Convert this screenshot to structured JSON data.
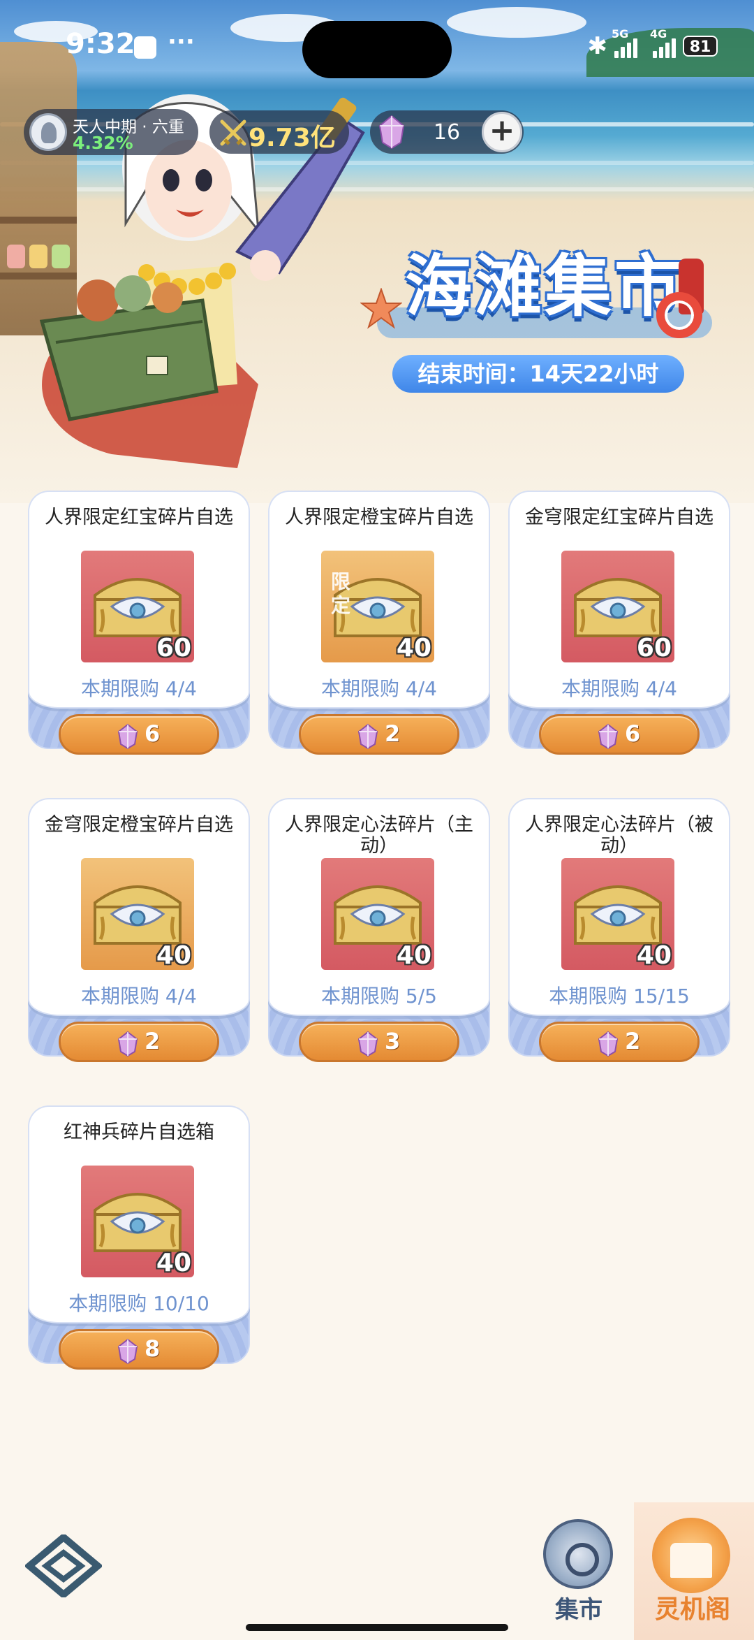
{
  "status_bar": {
    "time": "9:32",
    "more": "···",
    "bluetooth": "✱",
    "signal_1": "5G",
    "signal_2": "4G",
    "battery": "81"
  },
  "top_bar": {
    "realm_title": "天人中期 · 六重",
    "realm_percent": "4.32%",
    "power_value": "9.73亿",
    "gem_count": "16",
    "add_symbol": "+"
  },
  "event": {
    "title": "海滩集市",
    "end_time": "结束时间：14天22小时"
  },
  "shop": {
    "items": [
      {
        "title": "人界限定红宝碎片自选",
        "qty": "60",
        "limit": "本期限购 4/4",
        "price": "6",
        "bg": "red",
        "tag": ""
      },
      {
        "title": "人界限定橙宝碎片自选",
        "qty": "40",
        "limit": "本期限购 4/4",
        "price": "2",
        "bg": "orange",
        "tag": "限定"
      },
      {
        "title": "金穹限定红宝碎片自选",
        "qty": "60",
        "limit": "本期限购 4/4",
        "price": "6",
        "bg": "red",
        "tag": ""
      },
      {
        "title": "金穹限定橙宝碎片自选",
        "qty": "40",
        "limit": "本期限购 4/4",
        "price": "2",
        "bg": "orange",
        "tag": ""
      },
      {
        "title": "人界限定心法碎片（主动）",
        "qty": "40",
        "limit": "本期限购 5/5",
        "price": "3",
        "bg": "red",
        "tag": ""
      },
      {
        "title": "人界限定心法碎片（被动）",
        "qty": "40",
        "limit": "本期限购 15/15",
        "price": "2",
        "bg": "red",
        "tag": ""
      },
      {
        "title": "红神兵碎片自选箱",
        "qty": "40",
        "limit": "本期限购 10/10",
        "price": "8",
        "bg": "red",
        "tag": ""
      }
    ]
  },
  "nav": {
    "market_label": "集市",
    "lingji_label": "灵机阁"
  },
  "colors": {
    "accent_orange": "#e48a33",
    "limit_blue": "#6f93cf",
    "banner_blue": "#3f86e8"
  }
}
